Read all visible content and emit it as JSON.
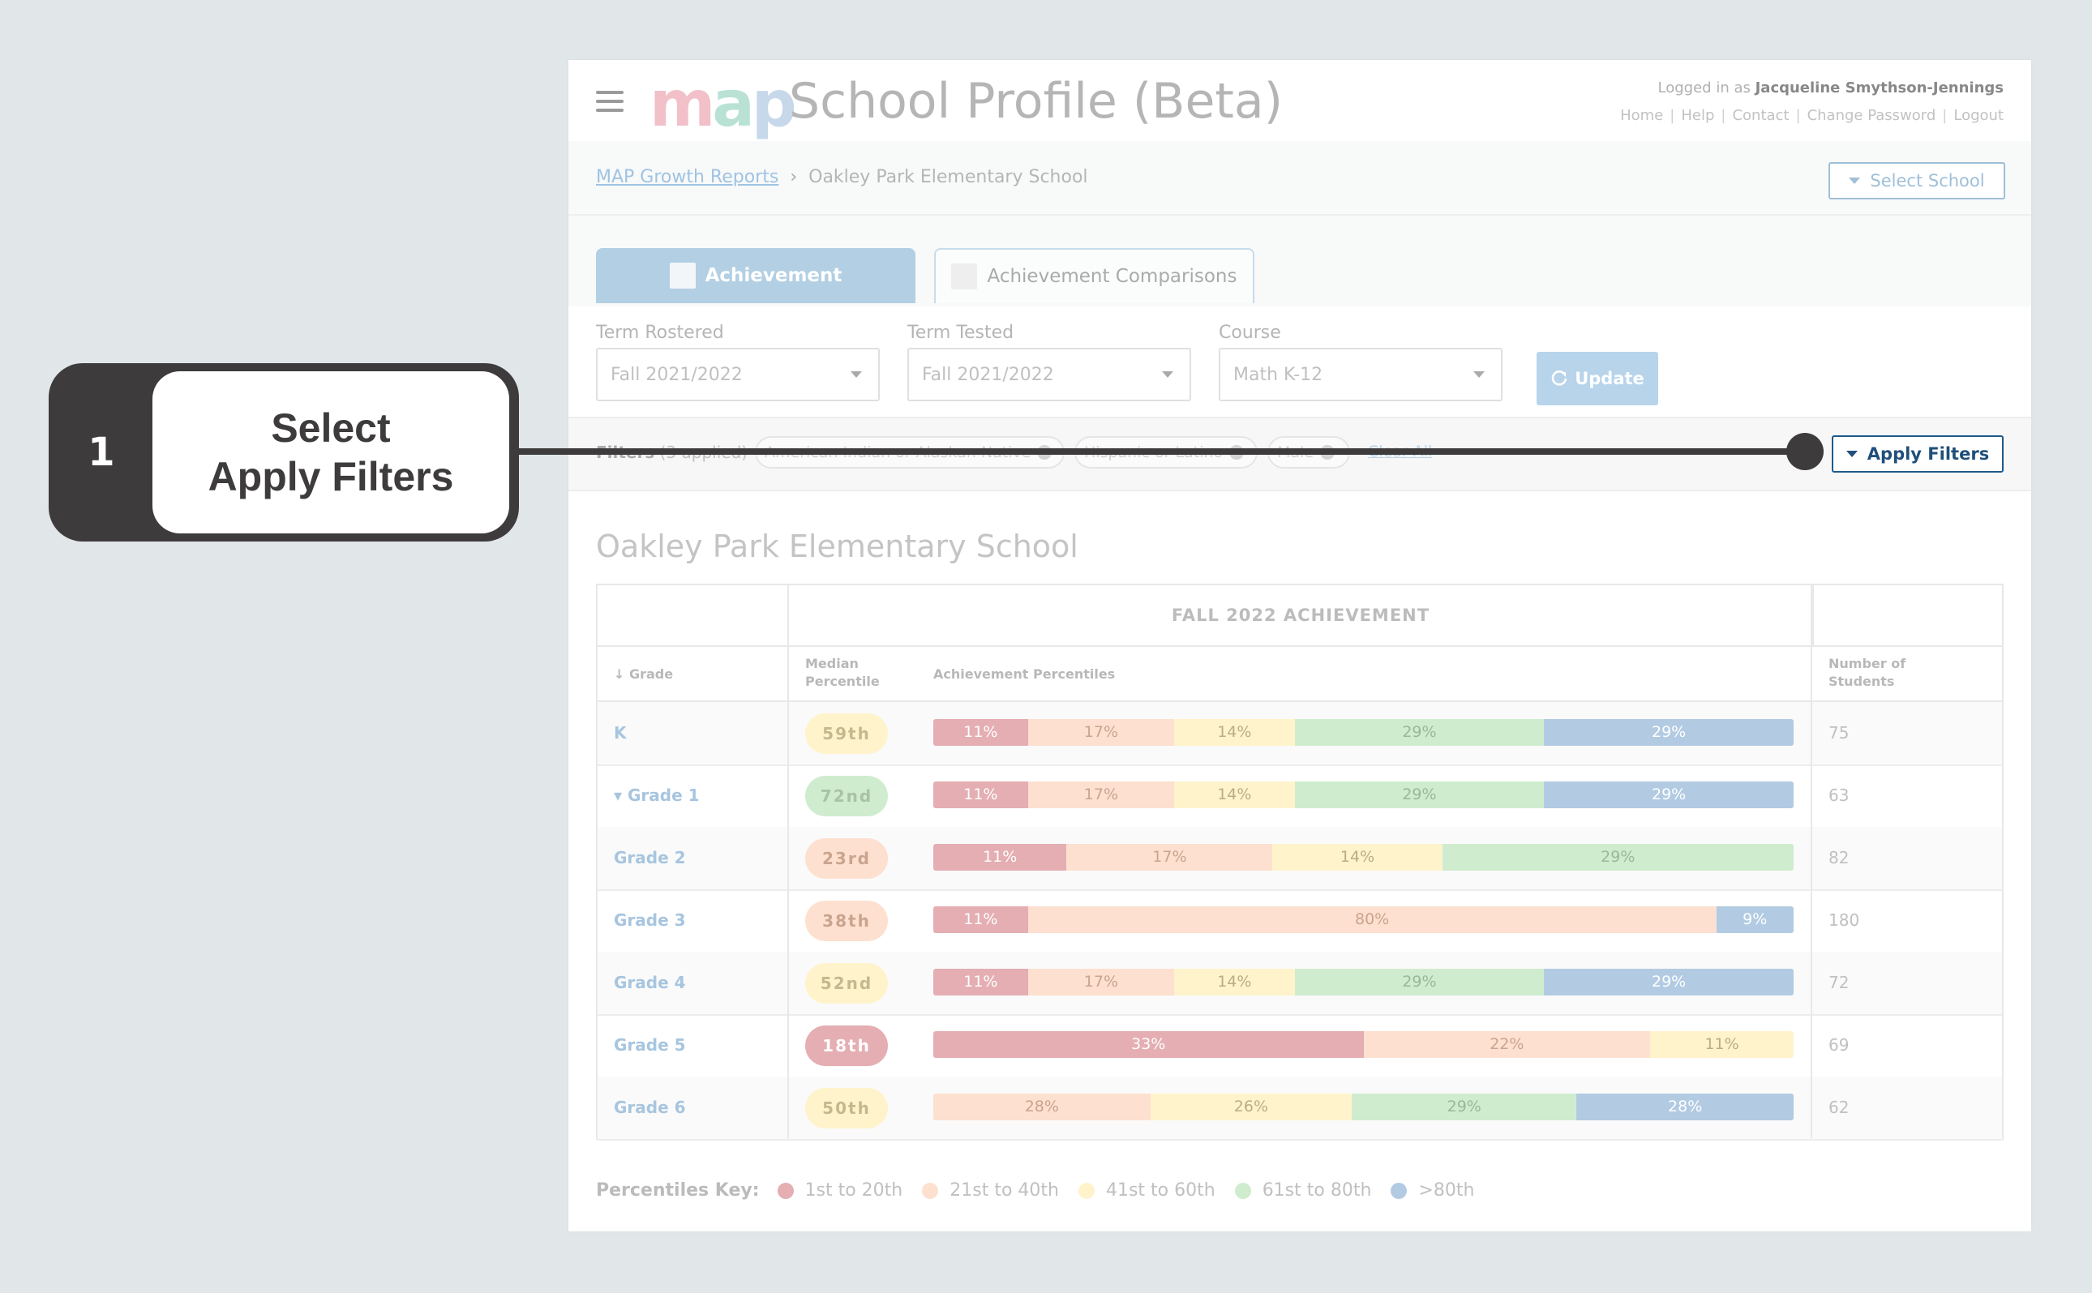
{
  "header": {
    "app_title": "School Profile (Beta)",
    "logo_text": "map",
    "logged_in_prefix": "Logged in as",
    "logged_in_user": "Jacqueline Smythson-Jennings",
    "links": [
      "Home",
      "Help",
      "Contact",
      "Change Password",
      "Logout"
    ]
  },
  "breadcrumb": {
    "root": "MAP Growth Reports",
    "current": "Oakley Park Elementary School",
    "select_school": "Select School"
  },
  "tabs": [
    {
      "label": "Achievement",
      "active": true
    },
    {
      "label": "Achievement Comparisons",
      "active": false
    }
  ],
  "controls": {
    "term_rostered": {
      "label": "Term Rostered",
      "value": "Fall 2021/2022"
    },
    "term_tested": {
      "label": "Term Tested",
      "value": "Fall 2021/2022"
    },
    "course": {
      "label": "Course",
      "value": "Math K-12"
    },
    "update": "Update"
  },
  "filters": {
    "label": "Filters",
    "count": "(3 applied)",
    "chips": [
      "American Indian or Alaskan Native",
      "Hispanic or Latino",
      "Male"
    ],
    "clear_all": "Clear All",
    "apply_button": "Apply Filters"
  },
  "school_name": "Oakley Park Elementary School",
  "table": {
    "group_header": "FALL 2022 ACHIEVEMENT",
    "col_grade": "Grade",
    "col_median": "Median Percentile",
    "col_median_l1": "Median",
    "col_median_l2": "Percentile",
    "col_achievement": "Achievement Percentiles",
    "col_students_l1": "Number of",
    "col_students_l2": "Students",
    "rows": [
      {
        "grade": "K",
        "median": "59th",
        "students": "75",
        "segments": [
          11,
          17,
          14,
          29,
          29
        ],
        "labels": [
          "11%",
          "17%",
          "14%",
          "29%",
          "29%"
        ]
      },
      {
        "grade": "Grade 1",
        "median": "72nd",
        "students": "63",
        "segments": [
          11,
          17,
          14,
          29,
          29
        ],
        "labels": [
          "11%",
          "17%",
          "14%",
          "29%",
          "29%"
        ]
      },
      {
        "grade": "Grade 2",
        "median": "23rd",
        "students": "82",
        "segments": [
          11,
          17,
          14,
          29,
          0
        ],
        "labels": [
          "11%",
          "17%",
          "14%",
          "29%",
          ""
        ]
      },
      {
        "grade": "Grade 3",
        "median": "38th",
        "students": "180",
        "segments": [
          11,
          80,
          0,
          0,
          9
        ],
        "labels": [
          "11%",
          "80%",
          "",
          "",
          "9%"
        ]
      },
      {
        "grade": "Grade 4",
        "median": "52nd",
        "students": "72",
        "segments": [
          11,
          17,
          14,
          29,
          29
        ],
        "labels": [
          "11%",
          "17%",
          "14%",
          "29%",
          "29%"
        ]
      },
      {
        "grade": "Grade 5",
        "median": "18th",
        "students": "69",
        "segments": [
          33,
          22,
          11,
          0,
          0
        ],
        "labels": [
          "33%",
          "22%",
          "11%",
          "",
          ""
        ]
      },
      {
        "grade": "Grade 6",
        "median": "50th",
        "students": "62",
        "segments": [
          0,
          28,
          26,
          29,
          28
        ],
        "labels": [
          "",
          "28%",
          "26%",
          "29%",
          "28%"
        ]
      }
    ]
  },
  "key": {
    "title": "Percentiles Key:",
    "items": [
      "1st to 20th",
      "21st to 40th",
      "41st to 60th",
      "61st to 80th",
      ">80th"
    ],
    "colors": [
      "#e4aeb2",
      "#fde0cf",
      "#fff3cb",
      "#cfeccf",
      "#b2cbe3"
    ]
  },
  "callout": {
    "step": "1",
    "line1": "Select",
    "line2": "Apply Filters"
  }
}
